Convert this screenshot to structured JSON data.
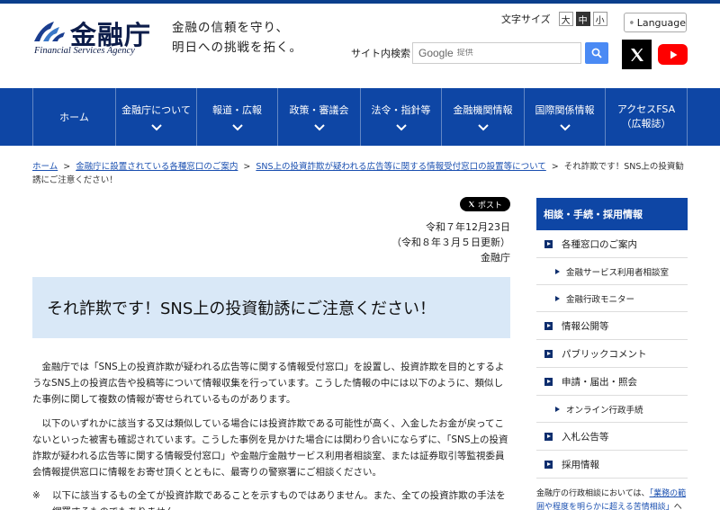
{
  "header": {
    "logo_kanji": "金融庁",
    "logo_en": "Financial Services Agency",
    "slogan_line1": "金融の信頼を守り、",
    "slogan_line2": "明日への挑戦を拓く。",
    "font_size_label": "文字サイズ",
    "font_sizes": [
      "大",
      "中",
      "小"
    ],
    "font_size_selected": "中",
    "language_label": "Language",
    "search_label": "サイト内検索",
    "search_brand": "Google",
    "search_placeholder": "提供"
  },
  "nav": {
    "items": [
      {
        "label": "ホーム"
      },
      {
        "label": "金融庁について"
      },
      {
        "label": "報道・広報"
      },
      {
        "label": "政策・審議会"
      },
      {
        "label": "法令・指針等"
      },
      {
        "label": "金融機関情報"
      },
      {
        "label": "国際関係情報"
      },
      {
        "label": "アクセスFSA（広報誌）"
      }
    ]
  },
  "breadcrumb": {
    "items": [
      "ホーム",
      "金融庁に設置されている各種窓口のご案内",
      "SNS上の投資詐欺が疑われる広告等に関する情報受付窓口の設置等について"
    ],
    "current": "それ詐欺です！SNS上の投資勧誘にご注意ください！"
  },
  "main": {
    "post_label": "ポスト",
    "date": "令和７年12月23日",
    "updated": "（令和８年３月５日更新）",
    "issuer": "金融庁",
    "title": "それ詐欺です！SNS上の投資勧誘にご注意ください！",
    "paragraph1": "金融庁では「SNS上の投資詐欺が疑われる広告等に関する情報受付窓口」を設置し、投資詐欺を目的とするようなSNS上の投資広告や投稿等について情報収集を行っています。こうした情報の中には以下のように、類似した事例に関して複数の情報が寄せられているものがあります。",
    "paragraph2": "以下のいずれかに該当する又は類似している場合には投資詐欺である可能性が高く、入金したお金が戻ってこないといった被害も確認されています。こうした事例を見かけた場合には関わり合いにならずに、「SNS上の投資詐欺が疑われる広告等に関する情報受付窓口」や金融庁金融サービス利用者相談室、または証券取引等監視委員会情報提供窓口に情報をお寄せ頂くとともに、最寄りの警察署にご相談ください。",
    "note_mark": "※",
    "note": "以下に該当するもの全てが投資詐欺であることを示すものではありません。また、全ての投資詐欺の手法を網羅するものでもありません。"
  },
  "sidebar": {
    "heading": "相談・手続・採用情報",
    "items": [
      {
        "label": "各種窓口のご案内",
        "level": "main"
      },
      {
        "label": "金融サービス利用者相談室",
        "level": "sub"
      },
      {
        "label": "金融行政モニター",
        "level": "sub"
      },
      {
        "label": "情報公開等",
        "level": "main"
      },
      {
        "label": "パブリックコメント",
        "level": "main"
      },
      {
        "label": "申請・届出・照会",
        "level": "main"
      },
      {
        "label": "オンライン行政手続",
        "level": "sub"
      },
      {
        "label": "入札公告等",
        "level": "main"
      },
      {
        "label": "採用情報",
        "level": "main"
      }
    ],
    "note_prefix": "金融庁の行政相談においては、",
    "note_link": "「業務の範囲や程度を明らかに超える苦情相談」",
    "note_suffix": "への"
  },
  "colors": {
    "nav_bg": "#0e46a5",
    "title_bg": "#d9e8f7",
    "link": "#1a4fb0",
    "youtube": "#ff0000"
  }
}
